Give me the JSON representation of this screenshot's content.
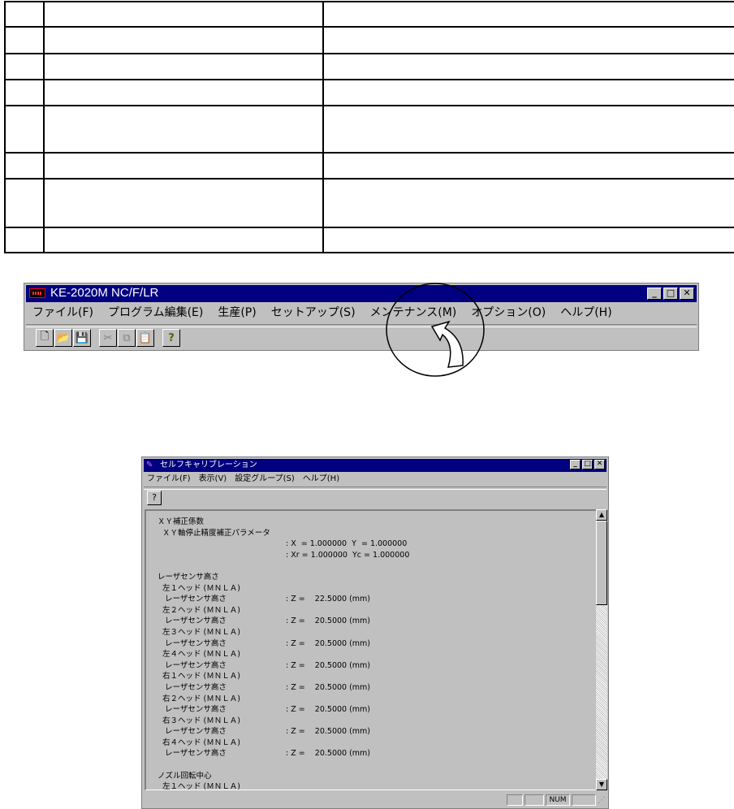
{
  "main_window": {
    "title": "KE-2020M NC/F/LR",
    "menu": [
      "ファイル(F)",
      "プログラム編集(E)",
      "生産(P)",
      "セットアップ(S)",
      "メンテナンス(M)",
      "オプション(O)",
      "ヘルプ(H)"
    ],
    "toolbar_icons": [
      "new-file-icon",
      "open-folder-icon",
      "save-icon",
      "cut-icon",
      "copy-icon",
      "paste-icon",
      "help-icon"
    ]
  },
  "sub_window": {
    "title": "セルフキャリブレーション",
    "menu": [
      "ファイル(F)",
      "表示(V)",
      "設定グループ(S)",
      "ヘルプ(H)"
    ],
    "lines": [
      {
        "label": "ＸＹ補正係数",
        "value": ""
      },
      {
        "label": "  ＸＹ軸停止精度補正パラメータ",
        "value": ""
      },
      {
        "label": "",
        "value": ": X  = 1.000000  Y  = 1.000000"
      },
      {
        "label": "",
        "value": ": Xr = 1.000000  Yc = 1.000000"
      },
      {
        "label": "",
        "value": ""
      },
      {
        "label": "レーザセンサ高さ",
        "value": ""
      },
      {
        "label": "  左１ヘッド (ＭＮＬＡ)",
        "value": ""
      },
      {
        "label": "   レーザセンサ高さ",
        "value": ": Z =    22.5000 (mm)"
      },
      {
        "label": "  左２ヘッド (ＭＮＬＡ)",
        "value": ""
      },
      {
        "label": "   レーザセンサ高さ",
        "value": ": Z =    20.5000 (mm)"
      },
      {
        "label": "  左３ヘッド (ＭＮＬＡ)",
        "value": ""
      },
      {
        "label": "   レーザセンサ高さ",
        "value": ": Z =    20.5000 (mm)"
      },
      {
        "label": "  左４ヘッド (ＭＮＬＡ)",
        "value": ""
      },
      {
        "label": "   レーザセンサ高さ",
        "value": ": Z =    20.5000 (mm)"
      },
      {
        "label": "  右１ヘッド (ＭＮＬＡ)",
        "value": ""
      },
      {
        "label": "   レーザセンサ高さ",
        "value": ": Z =    20.5000 (mm)"
      },
      {
        "label": "  右２ヘッド (ＭＮＬＡ)",
        "value": ""
      },
      {
        "label": "   レーザセンサ高さ",
        "value": ": Z =    20.5000 (mm)"
      },
      {
        "label": "  右３ヘッド (ＭＮＬＡ)",
        "value": ""
      },
      {
        "label": "   レーザセンサ高さ",
        "value": ": Z =    20.5000 (mm)"
      },
      {
        "label": "  右４ヘッド (ＭＮＬＡ)",
        "value": ""
      },
      {
        "label": "   レーザセンサ高さ",
        "value": ": Z =    20.5000 (mm)"
      },
      {
        "label": "",
        "value": ""
      },
      {
        "label": "ノズル回転中心",
        "value": ""
      },
      {
        "label": "  左１ヘッド (ＭＮＬＡ)",
        "value": ""
      }
    ],
    "status_num": "NUM"
  }
}
